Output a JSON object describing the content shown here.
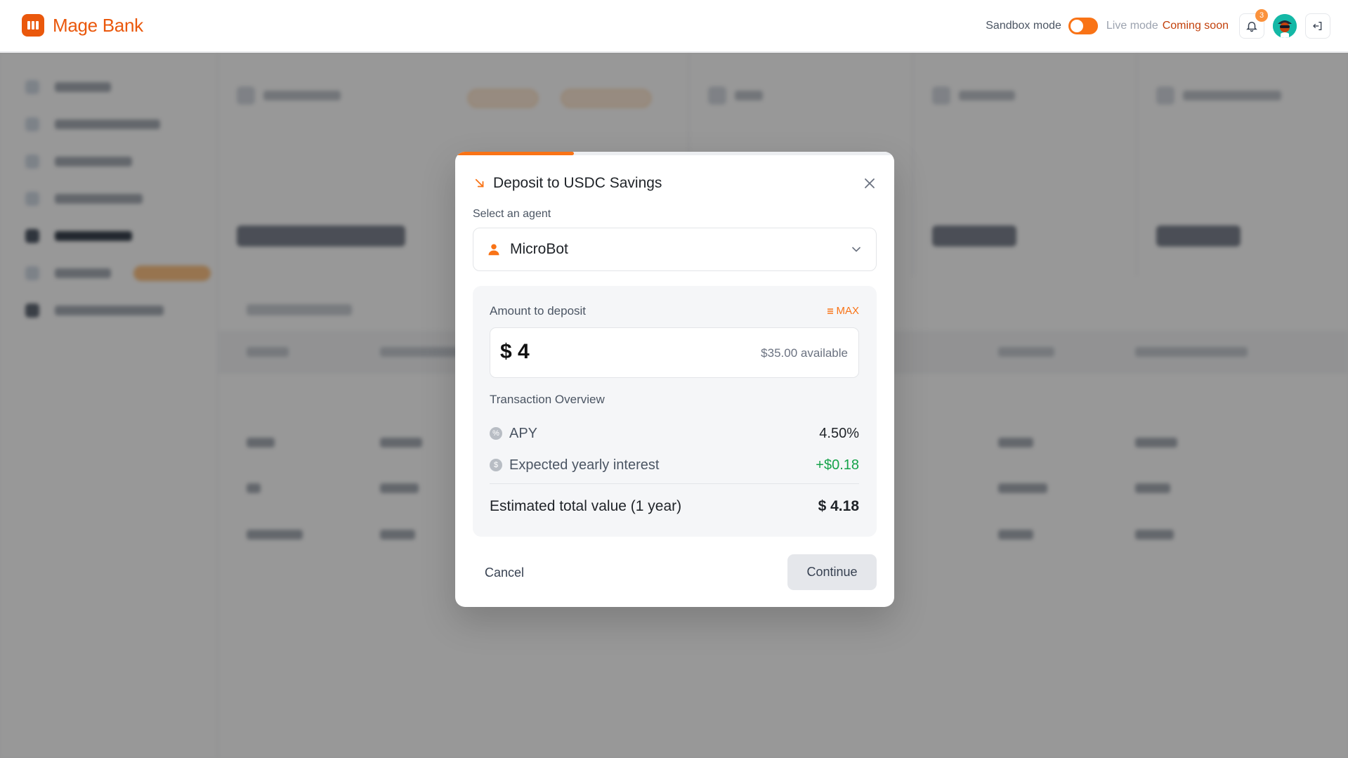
{
  "app": {
    "name": "Mage Bank"
  },
  "header": {
    "sandbox_label": "Sandbox mode",
    "live_label": "Live mode",
    "coming_soon": "Coming soon",
    "notifications_count": "3"
  },
  "modal": {
    "title": "Deposit to USDC Savings",
    "progress_fraction": 0.27,
    "select_label": "Select an agent",
    "selected_agent": "MicroBot",
    "amount_label": "Amount to deposit",
    "max_label": "MAX",
    "amount_value": "$ 4",
    "available": "$35.00 available",
    "overview_label": "Transaction Overview",
    "apy_label": "APY",
    "apy_value": "4.50%",
    "interest_label": "Expected yearly interest",
    "interest_value": "+$0.18",
    "total_label": "Estimated total value (1 year)",
    "total_value": "$ 4.18",
    "cancel_label": "Cancel",
    "continue_label": "Continue"
  },
  "colors": {
    "brand": "#ea580c",
    "accent": "#f97316",
    "positive": "#16a34a"
  }
}
